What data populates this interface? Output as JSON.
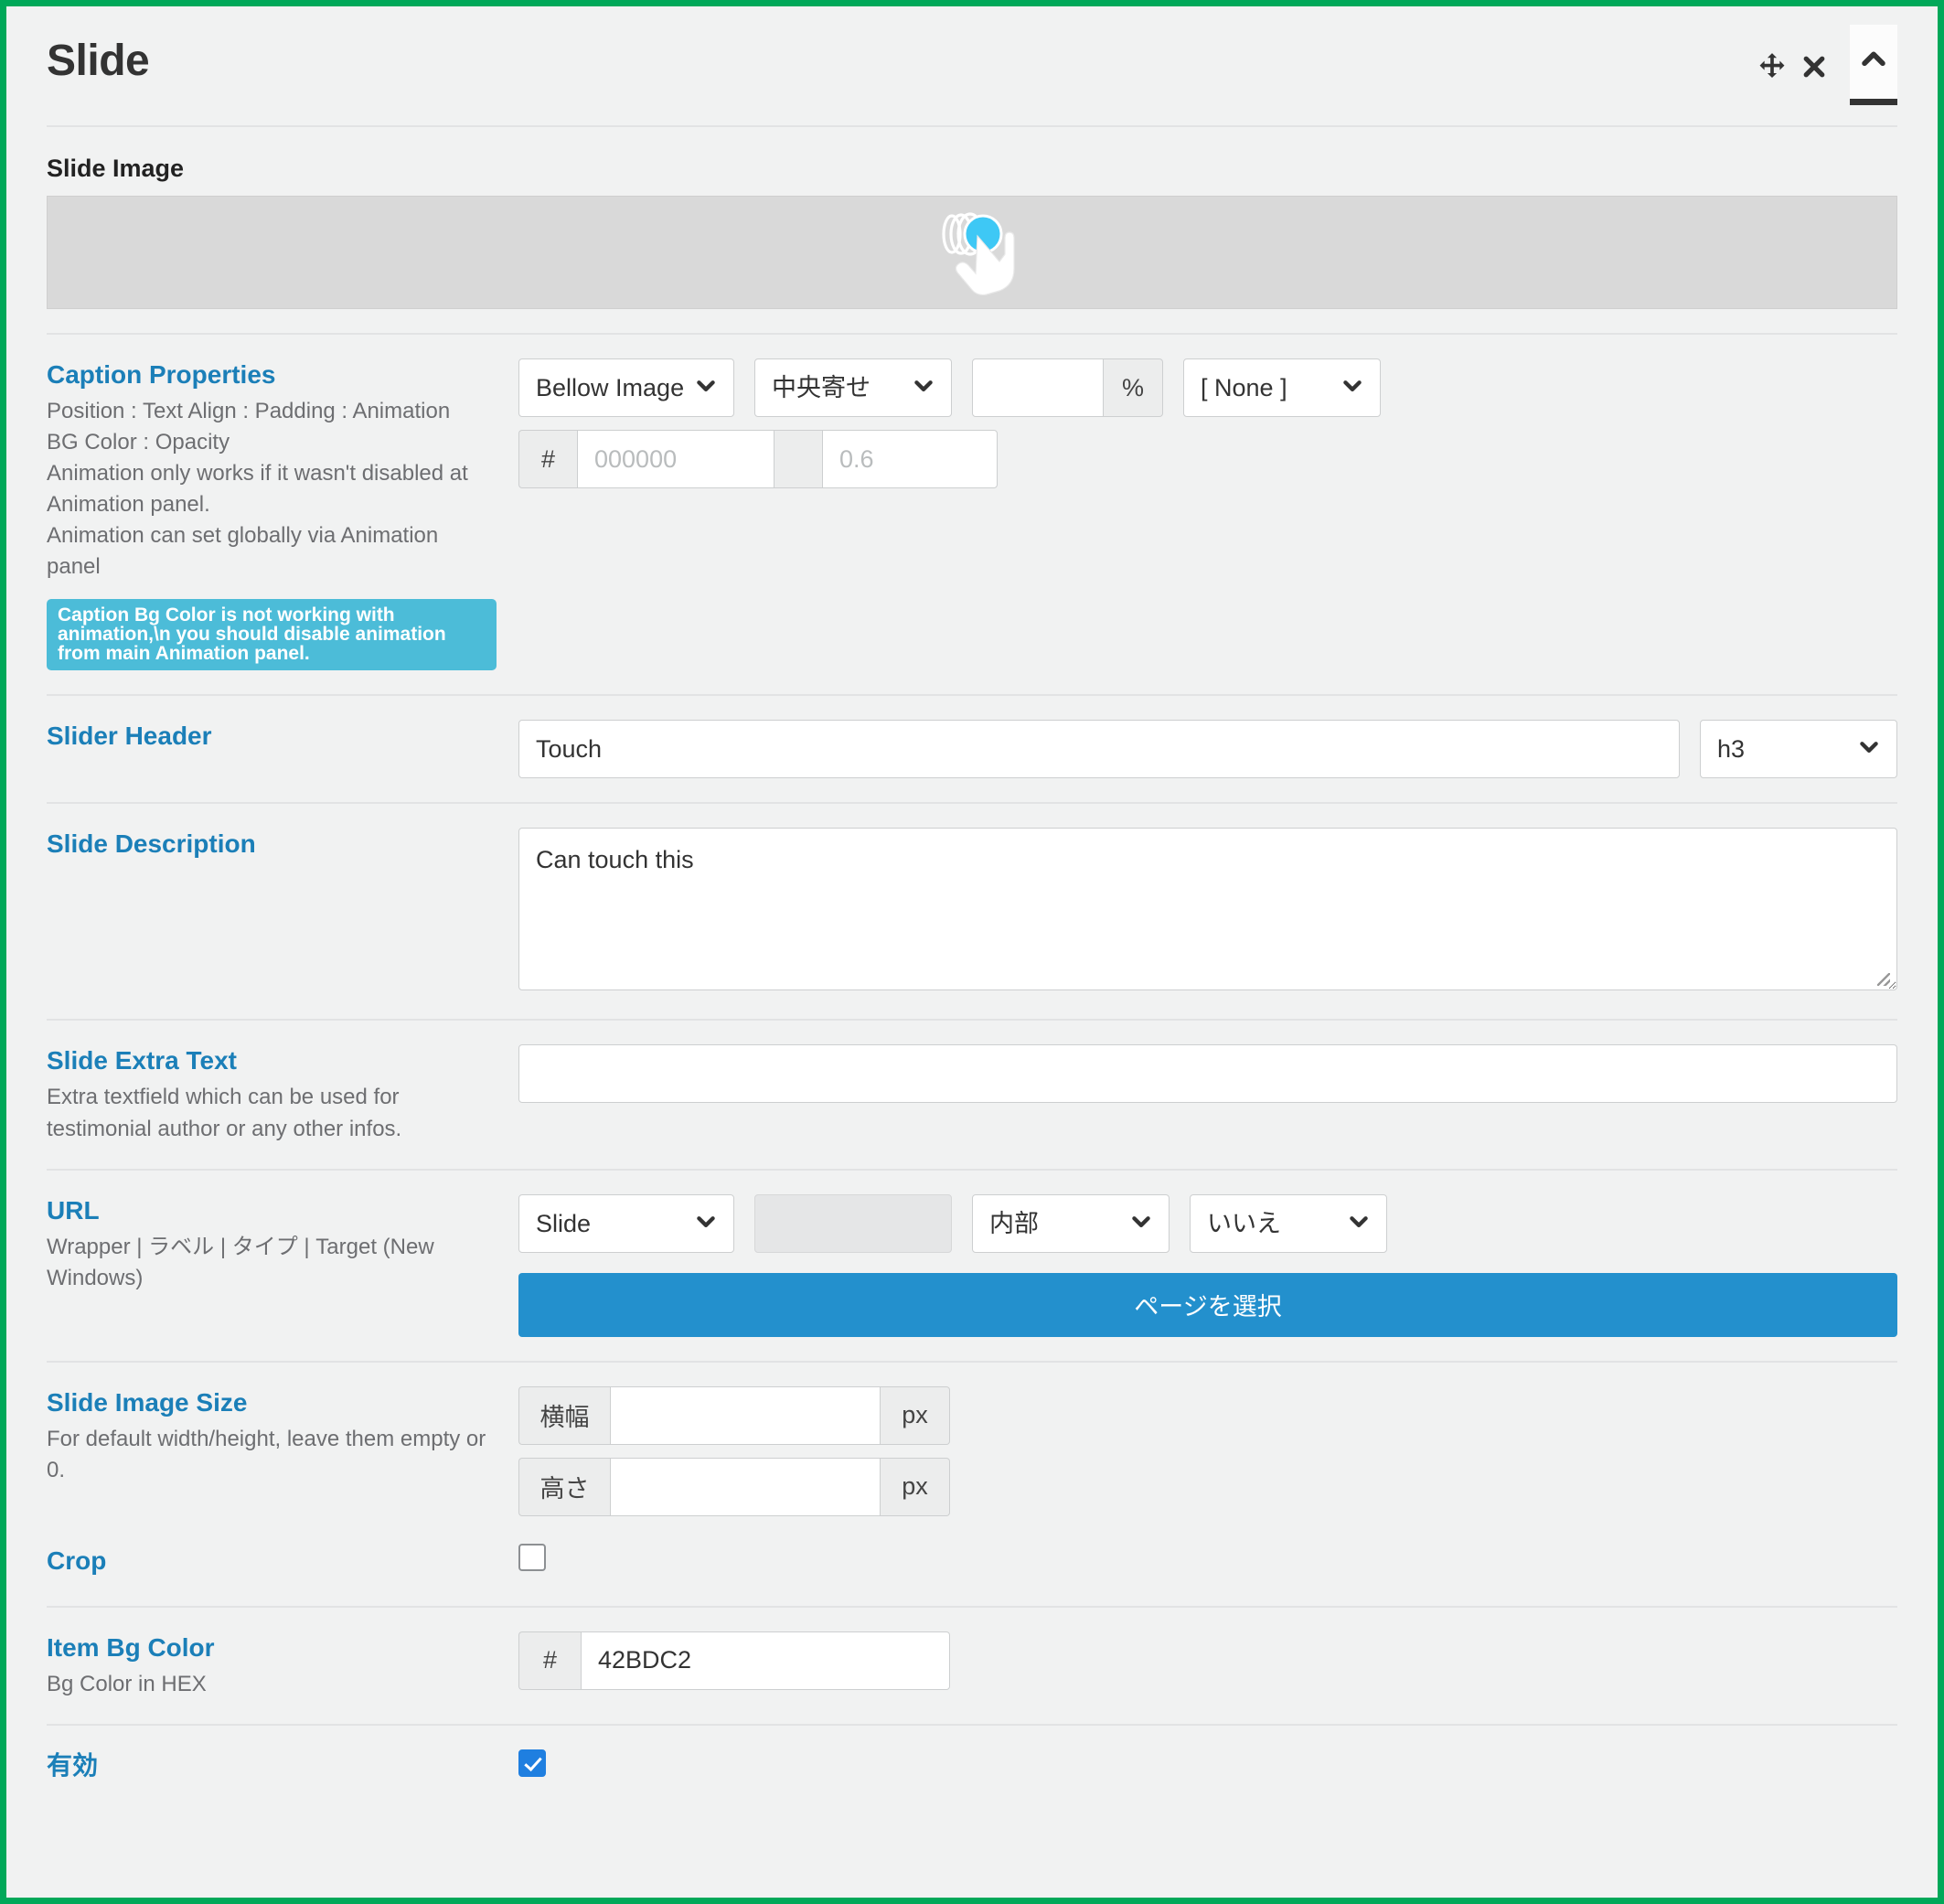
{
  "panel": {
    "title": "Slide",
    "border_color": "#00a859",
    "tools": [
      {
        "name": "move-icon",
        "glyph": "move"
      },
      {
        "name": "close-icon",
        "glyph": "close"
      },
      {
        "name": "collapse-icon",
        "glyph": "chevron-up"
      }
    ]
  },
  "slide_image": {
    "label": "Slide Image",
    "preview_icon": "touch-gesture-icon",
    "preview_bg": "#d9d9d9",
    "ripple_color": "#3ec8f5"
  },
  "caption_properties": {
    "title": "Caption Properties",
    "desc_lines": [
      "Position : Text Align : Padding : Animation",
      "BG Color : Opacity",
      "Animation only works if it wasn't disabled at Animation panel.",
      "Animation can set globally via Animation panel"
    ],
    "notice": "Caption Bg Color is not working with animation,\\n you should disable animation from main Animation panel.",
    "notice_color": "#4cbcd8",
    "position_value": "Bellow Image",
    "text_align_value": "中央寄せ",
    "padding_value": "",
    "padding_unit": "%",
    "animation_value": "[ None ]",
    "bg_color_prefix": "#",
    "bg_color_placeholder": "000000",
    "bg_color_value": "",
    "opacity_placeholder": "0.6",
    "opacity_value": ""
  },
  "slider_header": {
    "label": "Slider Header",
    "value": "Touch",
    "tag_value": "h3"
  },
  "slide_description": {
    "label": "Slide Description",
    "value": "Can touch this"
  },
  "slide_extra_text": {
    "label": "Slide Extra Text",
    "desc": "Extra textfield which can be used for testimonial author or any other infos.",
    "value": "",
    "placeholder": ""
  },
  "url": {
    "label": "URL",
    "desc": "Wrapper | ラベル | タイプ | Target (New Windows)",
    "wrapper_value": "Slide",
    "label_value": "",
    "type_value": "内部",
    "target_value": "いいえ",
    "select_page_button": "ページを選択",
    "button_color": "#2390cd"
  },
  "slide_image_size": {
    "label": "Slide Image Size",
    "desc": "For default width/height, leave them empty or 0.",
    "width_addon": "横幅",
    "width_value": "",
    "width_unit": "px",
    "height_addon": "高さ",
    "height_value": "",
    "height_unit": "px"
  },
  "crop": {
    "label": "Crop",
    "checked": false
  },
  "item_bg_color": {
    "label": "Item Bg Color",
    "desc": "Bg Color in HEX",
    "prefix": "#",
    "value": "42BDC2"
  },
  "enabled": {
    "label": "有効",
    "checked": true,
    "accent": "#1f7fe0"
  }
}
